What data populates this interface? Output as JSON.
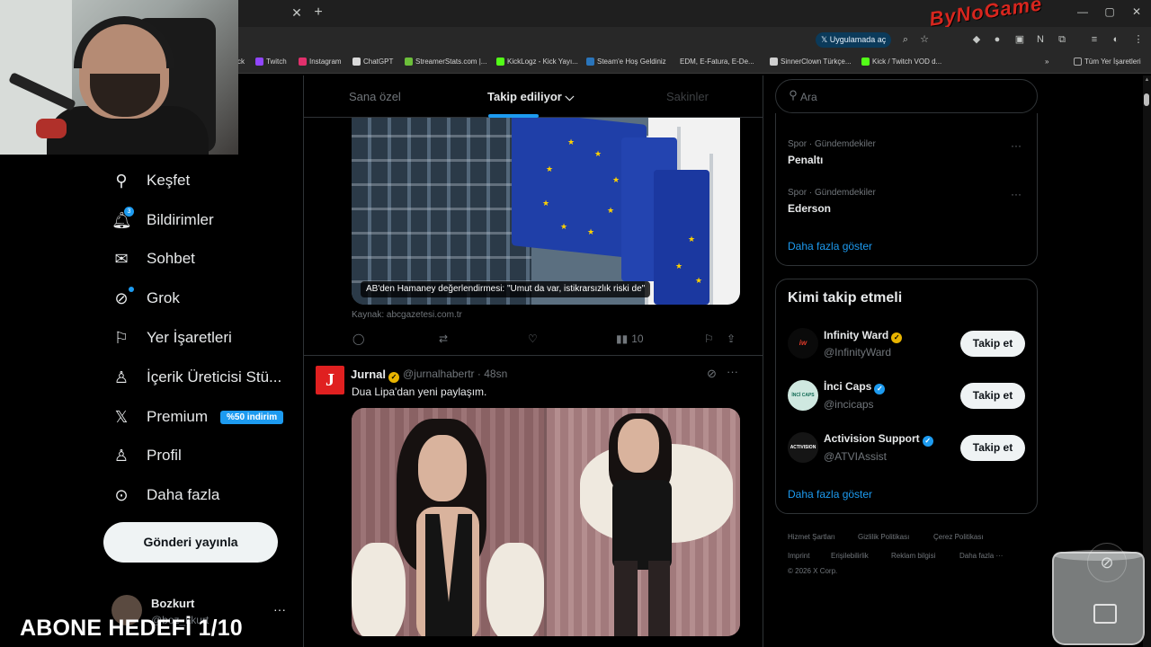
{
  "browser": {
    "open_in_app": "Uygulamada aç",
    "bookmarks": [
      "ck",
      "Twitch",
      "Instagram",
      "ChatGPT",
      "StreamerStats.com |...",
      "KickLogz - Kick Yayı...",
      "Steam'e Hoş Geldiniz",
      "EDM, E-Fatura, E-De...",
      "SinnerClown Türkçe...",
      "Kick / Twitch VOD d...",
      "Tüm Yer İşaretleri"
    ],
    "colors": {
      "tab_bar": "#1f1f1f",
      "toolbar": "#282828"
    }
  },
  "overlay": {
    "logo": "ByNoGame",
    "subscriber_goal": "ABONE HEDEFİ 1/10"
  },
  "nav": {
    "items": [
      {
        "label": "Keşfet",
        "icon": "search-icon"
      },
      {
        "label": "Bildirimler",
        "icon": "bell-icon",
        "badge": "3"
      },
      {
        "label": "Sohbet",
        "icon": "mail-icon"
      },
      {
        "label": "Grok",
        "icon": "grok-icon"
      },
      {
        "label": "Yer İşaretleri",
        "icon": "bookmark-icon"
      },
      {
        "label": "İçerik Üreticisi Stü...",
        "icon": "creator-studio-icon"
      },
      {
        "label": "Premium",
        "icon": "x-logo-icon",
        "promo": "%50 indirim"
      },
      {
        "label": "Profil",
        "icon": "person-icon"
      },
      {
        "label": "Daha fazla",
        "icon": "more-circle-icon"
      }
    ],
    "post_button": "Gönderi yayınla",
    "account": {
      "name": "Bozkurt",
      "handle": "@boz_kkurt"
    }
  },
  "feed": {
    "tabs": [
      "Sana özel",
      "Takip ediliyor",
      "Sakinler"
    ],
    "active_tab": "Takip ediliyor",
    "post1": {
      "media_caption": "AB'den Hamaney değerlendirmesi: \"Umut da var, istikrarsızlık riski de\"",
      "source": "Kaynak: abcgazetesi.com.tr",
      "views": "10"
    },
    "post2": {
      "avatar_letter": "J",
      "name": "Jurnal",
      "handle": "@jurnalhabertr",
      "time": "48sn",
      "text": "Dua Lipa'dan yeni paylaşım."
    }
  },
  "sidebar": {
    "search_placeholder": "Ara",
    "trends": [
      {
        "meta": "Spor · Gündemdekiler",
        "name": "Penaltı"
      },
      {
        "meta": "Spor · Gündemdekiler",
        "name": "Ederson"
      }
    ],
    "trends_show_more": "Daha fazla göster",
    "who_to_follow_title": "Kimi takip etmeli",
    "who_to_follow": [
      {
        "name": "Infinity Ward",
        "handle": "@InfinityWard",
        "verified": "gold",
        "avatar_text": "iw"
      },
      {
        "name": "İnci Caps",
        "handle": "@incicaps",
        "verified": "blue",
        "avatar_text": "İNCİ CAPS"
      },
      {
        "name": "Activision Support",
        "handle": "@ATVIAssist",
        "verified": "blue",
        "avatar_text": "ACTIVISION"
      }
    ],
    "follow_label": "Takip et",
    "wtf_show_more": "Daha fazla göster",
    "footer": [
      "Hizmet Şartları",
      "Gizlilik Politikası",
      "Çerez Politikası",
      "Imprint",
      "Erişilebilirlik",
      "Reklam bilgisi",
      "Daha fazla ···"
    ],
    "copyright": "© 2026 X Corp."
  },
  "colors": {
    "accent": "#1d9bf0",
    "background": "#000000",
    "gold_check": "#e8b400"
  }
}
